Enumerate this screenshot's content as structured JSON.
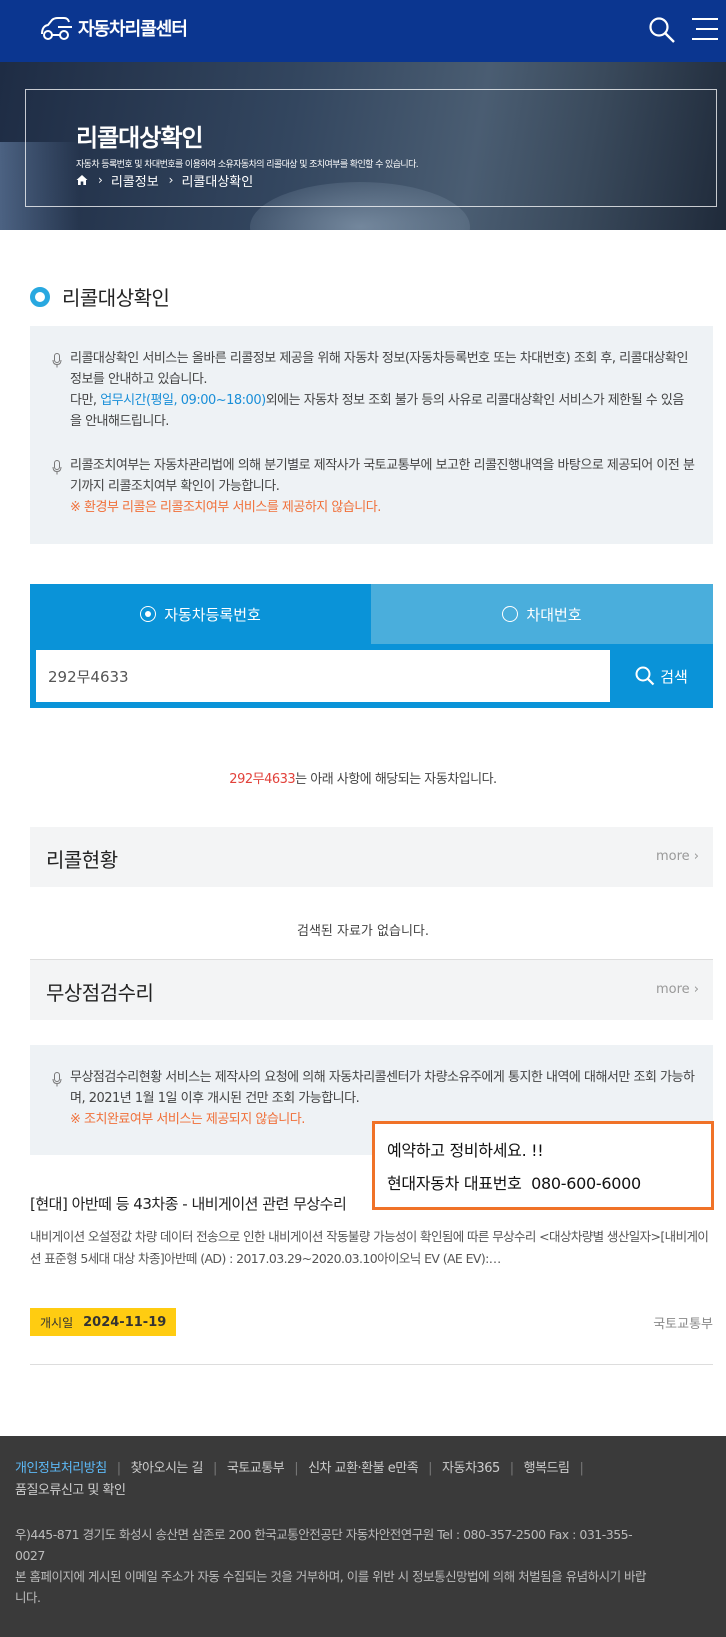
{
  "header": {
    "logo_text": "자동차리콜센터",
    "brand_color": "#0b3690"
  },
  "hero": {
    "title": "리콜대상확인",
    "subtitle": "자동차 등록번호 및 차대번호를 이용하여 소유자동차의 리콜대상 및 조치여부를 확인할 수 있습니다.",
    "breadcrumb": [
      "리콜정보",
      "리콜대상확인"
    ]
  },
  "section_title": "리콜대상확인",
  "notice": {
    "p1_line": "리콜대상확인 서비스는 올바른 리콜정보 제공을 위해 자동차 정보(자동차등록번호 또는 차대번호) 조회 후, 리콜대상확인 정보를 안내하고 있습니다.",
    "p1_prefix": "다만, ",
    "p1_highlight": "업무시간(평일, 09:00~18:00)",
    "p1_suffix": "외에는 자동차 정보 조회 불가 등의 사유로 리콜대상확인 서비스가 제한될 수 있음을 안내해드립니다.",
    "p2_line": "리콜조치여부는 자동차관리법에 의해 분기별로 제작사가 국토교통부에 보고한 리콜진행내역을 바탕으로 제공되어 이전 분기까지 리콜조치여부 확인이 가능합니다.",
    "p2_warning": "※ 환경부 리콜은 리콜조치여부 서비스를 제공하지 않습니다."
  },
  "tabs": [
    {
      "label": "자동차등록번호",
      "selected": true
    },
    {
      "label": "차대번호",
      "selected": false
    }
  ],
  "search": {
    "value": "292무4633",
    "button_label": "검색"
  },
  "result": {
    "plate": "292무4633",
    "message": "는 아래 사항에 해당되는 자동차입니다."
  },
  "recall_status": {
    "title": "리콜현황",
    "more": "more",
    "empty": "검색된 자료가 없습니다."
  },
  "free_repair": {
    "title": "무상점검수리",
    "more": "more",
    "notice": "무상점검수리현황 서비스는 제작사의 요청에 의해 자동차리콜센터가 차량소유주에게 통지한 내역에 대해서만 조회 가능하며, 2021년 1월 1일 이후 개시된 건만 조회 가능합니다.",
    "warning": "※ 조치완료여부 서비스는 제공되지 않습니다."
  },
  "popup": {
    "line1": "예약하고 정비하세요. !!",
    "line2_label": "현대자동차 대표번호",
    "line2_number": "080-600-6000"
  },
  "news": {
    "title": "[현대] 아반떼 등 43차종 - 내비게이션 관련 무상수리",
    "body": "내비게이션 오설정값 차량 데이터 전송으로 인한 내비게이션 작동불량 가능성이 확인됨에 따른 무상수리 <대상차량별 생산일자>[내비게이션 표준형 5세대 대상 차종]아반떼 (AD) : 2017.03.29~2020.03.10아이오닉 EV (AE EV):…",
    "badge_label": "개시일",
    "badge_date": "2024-11-19",
    "source": "국토교통부"
  },
  "footer": {
    "links": [
      "개인정보처리방침",
      "찾아오시는 길",
      "국토교통부",
      "신차 교환·환불 e만족",
      "자동차365",
      "행복드림",
      "품질오류신고 및 확인"
    ],
    "address": "우)445-871 경기도 화성시 송산면 삼존로 200 한국교통안전공단 자동차안전연구원 Tel : 080-357-2500 Fax : 031-355-0027",
    "notice": "본 홈페이지에 게시된 이메일 주소가 자동 수집되는 것을 거부하며, 이를 위반 시 정보통신망법에 의해 처벌됨을 유념하시기 바랍니다."
  },
  "colors": {
    "accent": "#0a93d8",
    "tab_inactive": "#4aaedc",
    "highlight_blue": "#1a8fd8",
    "warning_orange": "#f0703a",
    "plate_red": "#e2413a",
    "badge_yellow": "#ffcc11",
    "popup_border": "#f07228"
  },
  "icons": [
    "car-logo-icon",
    "search-icon",
    "hamburger-menu-icon",
    "home-icon",
    "chevron-right-icon",
    "microphone-icon",
    "radio-icon"
  ]
}
